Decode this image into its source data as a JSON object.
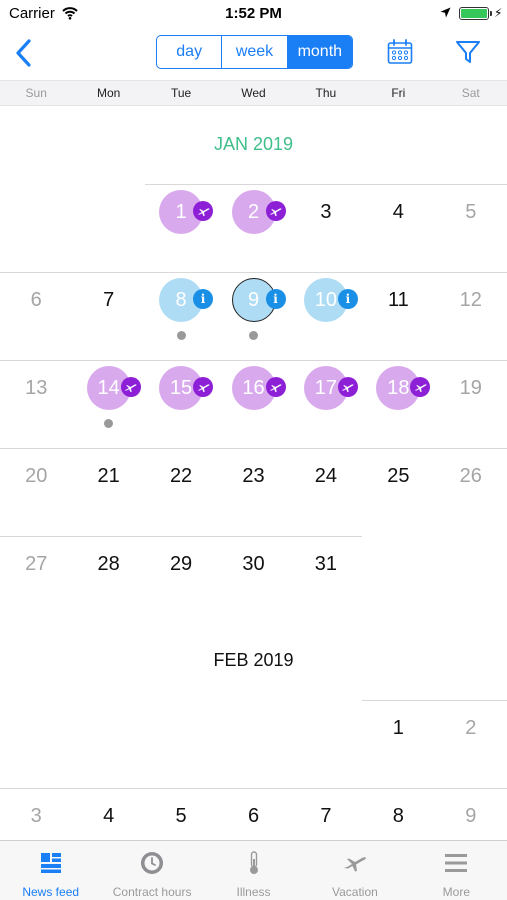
{
  "status_bar": {
    "carrier": "Carrier",
    "time": "1:52 PM"
  },
  "nav": {
    "segments": [
      {
        "label": "day",
        "active": false
      },
      {
        "label": "week",
        "active": false
      },
      {
        "label": "month",
        "active": true
      }
    ],
    "icons": {
      "back": "chevron-left-icon",
      "calendar": "calendar-icon",
      "filter": "filter-icon"
    }
  },
  "weekdays": [
    "Sun",
    "Mon",
    "Tue",
    "Wed",
    "Thu",
    "Fri",
    "Sat"
  ],
  "months": [
    {
      "title": "JAN 2019",
      "current": true,
      "weeks": [
        [
          null,
          null,
          {
            "d": "1",
            "m": "vacation"
          },
          {
            "d": "2",
            "m": "vacation"
          },
          {
            "d": "3"
          },
          {
            "d": "4"
          },
          {
            "d": "5"
          }
        ],
        [
          {
            "d": "6"
          },
          {
            "d": "7"
          },
          {
            "d": "8",
            "m": "info",
            "dot": true
          },
          {
            "d": "9",
            "m": "info",
            "today": true,
            "dot": true
          },
          {
            "d": "10",
            "m": "info"
          },
          {
            "d": "11"
          },
          {
            "d": "12"
          }
        ],
        [
          {
            "d": "13"
          },
          {
            "d": "14",
            "m": "vacation",
            "dot": true
          },
          {
            "d": "15",
            "m": "vacation"
          },
          {
            "d": "16",
            "m": "vacation"
          },
          {
            "d": "17",
            "m": "vacation"
          },
          {
            "d": "18",
            "m": "vacation"
          },
          {
            "d": "19"
          }
        ],
        [
          {
            "d": "20"
          },
          {
            "d": "21"
          },
          {
            "d": "22"
          },
          {
            "d": "23"
          },
          {
            "d": "24"
          },
          {
            "d": "25"
          },
          {
            "d": "26"
          }
        ],
        [
          {
            "d": "27"
          },
          {
            "d": "28"
          },
          {
            "d": "29"
          },
          {
            "d": "30"
          },
          {
            "d": "31"
          },
          null,
          null
        ]
      ]
    },
    {
      "title": "FEB 2019",
      "current": false,
      "weeks": [
        [
          null,
          null,
          null,
          null,
          null,
          {
            "d": "1"
          },
          {
            "d": "2"
          }
        ],
        [
          {
            "d": "3"
          },
          {
            "d": "4"
          },
          {
            "d": "5"
          },
          {
            "d": "6"
          },
          {
            "d": "7"
          },
          {
            "d": "8"
          },
          {
            "d": "9"
          }
        ]
      ]
    }
  ],
  "tabs": [
    {
      "label": "News feed",
      "icon": "news-feed-icon",
      "active": true
    },
    {
      "label": "Contract hours",
      "icon": "clock-icon",
      "active": false
    },
    {
      "label": "Illness",
      "icon": "thermometer-icon",
      "active": false
    },
    {
      "label": "Vacation",
      "icon": "airplane-icon",
      "active": false
    },
    {
      "label": "More",
      "icon": "menu-icon",
      "active": false
    }
  ],
  "colors": {
    "accent": "#1a7ef5",
    "month_title": "#3fbf8a",
    "vacation": "#d9a9ee",
    "vacation_badge": "#8d1fd6",
    "info": "#aedcf5",
    "info_badge": "#1a8fe6"
  }
}
